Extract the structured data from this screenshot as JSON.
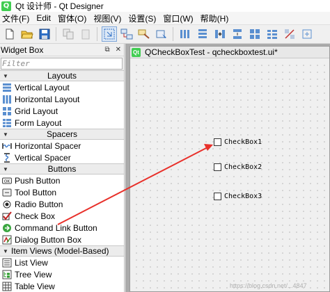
{
  "window": {
    "title": "Qt 设计师 - Qt Designer"
  },
  "menubar": {
    "items": [
      "文件(F)",
      "Edit",
      "窗体(O)",
      "视图(V)",
      "设置(S)",
      "窗口(W)",
      "帮助(H)"
    ]
  },
  "widget_box": {
    "title": "Widget Box",
    "filter_placeholder": "Filter",
    "categories": {
      "layouts": "Layouts",
      "spacers": "Spacers",
      "buttons": "Buttons",
      "item_views": "Item Views (Model-Based)"
    },
    "items": {
      "vertical_layout": "Vertical Layout",
      "horizontal_layout": "Horizontal Layout",
      "grid_layout": "Grid Layout",
      "form_layout": "Form Layout",
      "horizontal_spacer": "Horizontal Spacer",
      "vertical_spacer": "Vertical Spacer",
      "push_button": "Push Button",
      "tool_button": "Tool Button",
      "radio_button": "Radio Button",
      "check_box": "Check Box",
      "command_link_button": "Command Link Button",
      "dialog_button_box": "Dialog Button Box",
      "list_view": "List View",
      "tree_view": "Tree View",
      "table_view": "Table View"
    }
  },
  "form": {
    "title": "QCheckBoxTest - qcheckboxtest.ui*",
    "checkboxes": [
      "CheckBox1",
      "CheckBox2",
      "CheckBox3"
    ]
  },
  "watermark": "https://blog.csdn.net/...4847",
  "colors": {
    "annotation_arrow": "#e8302a",
    "qt_green": "#41cd52",
    "mdi_background": "#ababab"
  }
}
